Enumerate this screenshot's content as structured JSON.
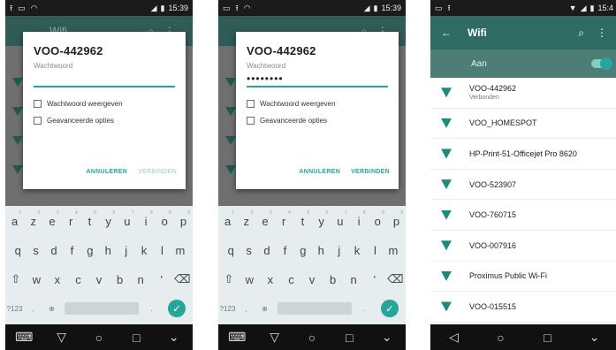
{
  "phone1": {
    "status": {
      "time": "15:39"
    },
    "background": {
      "title": "Wifi"
    },
    "dialog": {
      "network_name": "VOO-442962",
      "password_label": "Wachtwoord",
      "password_value": "",
      "show_password_label": "Wachtwoord weergeven",
      "advanced_label": "Geavanceerde opties",
      "cancel_label": "ANNULEREN",
      "connect_label": "VERBINDEN"
    },
    "keyboard": {
      "row1": [
        "a",
        "z",
        "e",
        "r",
        "t",
        "y",
        "u",
        "i",
        "o",
        "p"
      ],
      "row1_nums": [
        "1",
        "2",
        "3",
        "4",
        "5",
        "6",
        "7",
        "8",
        "9",
        "0"
      ],
      "row2": [
        "q",
        "s",
        "d",
        "f",
        "g",
        "h",
        "j",
        "k",
        "l",
        "m"
      ],
      "row3": [
        "w",
        "x",
        "c",
        "v",
        "b",
        "n",
        "'"
      ],
      "symbols_label": "?123",
      "comma": ",",
      "period": "."
    }
  },
  "phone2": {
    "status": {
      "time": "15:39"
    },
    "dialog": {
      "network_name": "VOO-442962",
      "password_label": "Wachtwoord",
      "password_value": "••••••••",
      "show_password_label": "Wachtwoord weergeven",
      "advanced_label": "Geavanceerde opties",
      "cancel_label": "ANNULEREN",
      "connect_label": "VERBINDEN"
    },
    "keyboard": {
      "row1": [
        "a",
        "z",
        "e",
        "r",
        "t",
        "y",
        "u",
        "i",
        "o",
        "p"
      ],
      "row1_nums": [
        "1",
        "2",
        "3",
        "4",
        "5",
        "6",
        "7",
        "8",
        "9",
        "0"
      ],
      "row2": [
        "q",
        "s",
        "d",
        "f",
        "g",
        "h",
        "j",
        "k",
        "l",
        "m"
      ],
      "row3": [
        "w",
        "x",
        "c",
        "v",
        "b",
        "n",
        "'"
      ],
      "symbols_label": "?123",
      "comma": ",",
      "period": "."
    }
  },
  "phone3": {
    "status": {
      "time": "15:4"
    },
    "toolbar": {
      "title": "Wifi"
    },
    "switch_label": "Aan",
    "networks": [
      {
        "name": "VOO-442962",
        "status": "Verbonden"
      },
      {
        "name": "VOO_HOMESPOT"
      },
      {
        "name": "HP-Print-51-Officejet Pro 8620"
      },
      {
        "name": "VOO-523907"
      },
      {
        "name": "VOO-760715"
      },
      {
        "name": "VOO-007916"
      },
      {
        "name": "Proximus Public Wi-Fi"
      },
      {
        "name": "VOO-015515"
      }
    ]
  },
  "colors": {
    "accent": "#26a69a",
    "toolbar": "#2e6b63"
  }
}
